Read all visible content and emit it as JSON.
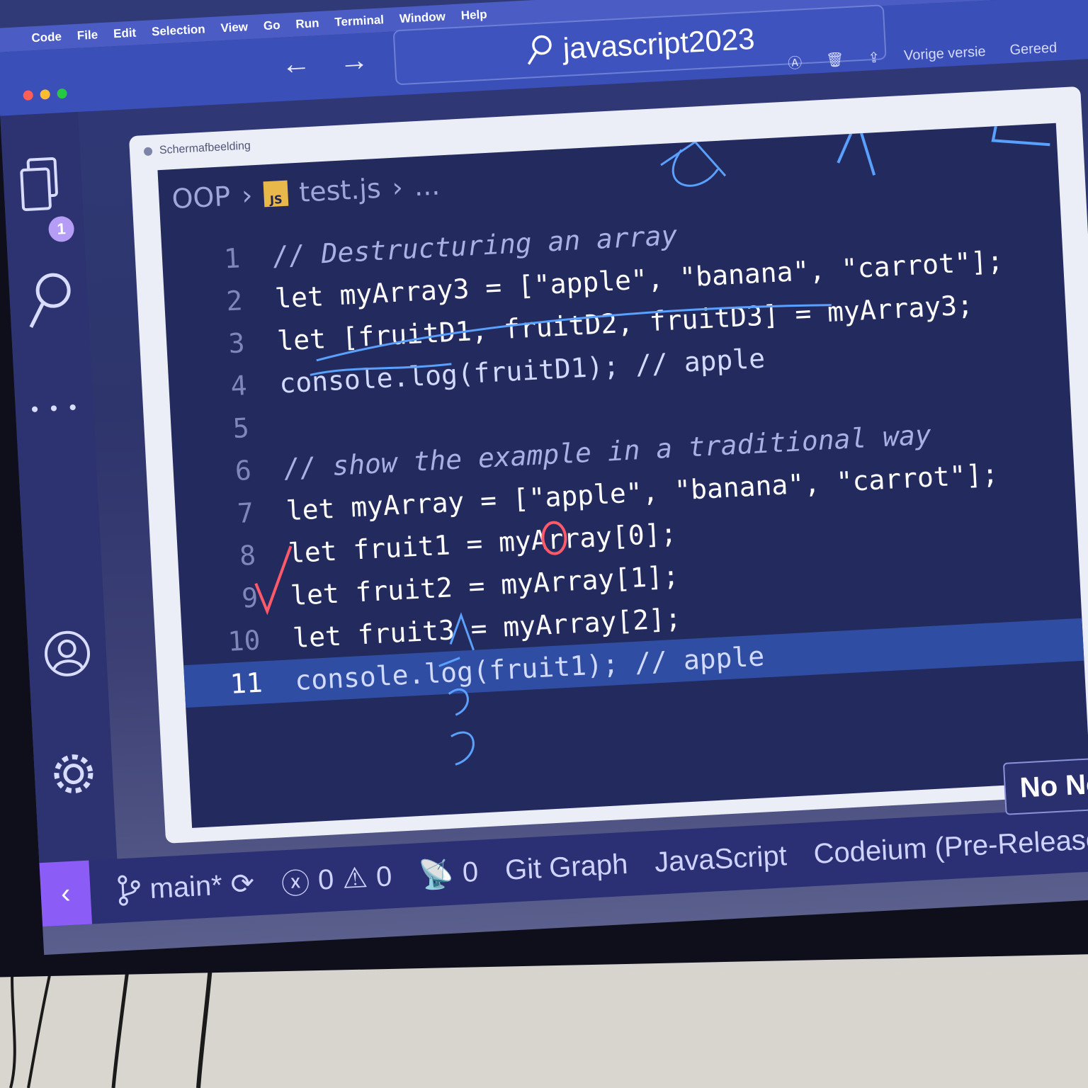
{
  "menubar": {
    "app": "Code",
    "items": [
      "File",
      "Edit",
      "Selection",
      "View",
      "Go",
      "Run",
      "Terminal",
      "Window",
      "Help"
    ]
  },
  "titlebar": {
    "search": "javascript2023"
  },
  "preview": {
    "title": "Schermafbeelding",
    "actions": {
      "previous": "Vorige versie",
      "done": "Gereed"
    }
  },
  "activity": {
    "badge": "1",
    "more": "• • •"
  },
  "breadcrumb": {
    "folder": "OOP",
    "file_icon": "JS",
    "file": "test.js",
    "more": "..."
  },
  "code_lines": [
    {
      "n": "1",
      "code": "// Destructuring an array"
    },
    {
      "n": "2",
      "code": "let myArray3 = [\"apple\", \"banana\", \"carrot\"];"
    },
    {
      "n": "3",
      "code": "let [fruitD1, fruitD2, fruitD3] = myArray3;"
    },
    {
      "n": "4",
      "code": "console.log(fruitD1); // apple"
    },
    {
      "n": "5",
      "code": ""
    },
    {
      "n": "6",
      "code": "// show the example in a traditional way"
    },
    {
      "n": "7",
      "code": "let myArray = [\"apple\", \"banana\", \"carrot\"];"
    },
    {
      "n": "8",
      "code": "let fruit1 = myArray[0];"
    },
    {
      "n": "9",
      "code": "let fruit2 = myArray[1];"
    },
    {
      "n": "10",
      "code": "let fruit3 = myArray[2];"
    },
    {
      "n": "11",
      "code": "console.log(fruit1); // apple"
    }
  ],
  "statusbar": {
    "branch": "main*",
    "errors": "0",
    "warnings": "0",
    "ports": "0",
    "git_graph": "Git Graph",
    "language": "JavaScript",
    "codeium": "Codeium (Pre-Release):"
  },
  "notification": "No Not",
  "colors": {
    "accent": "#4b5dc4",
    "editor_bg": "#232a5e",
    "statusbar": "#2b2f73"
  }
}
